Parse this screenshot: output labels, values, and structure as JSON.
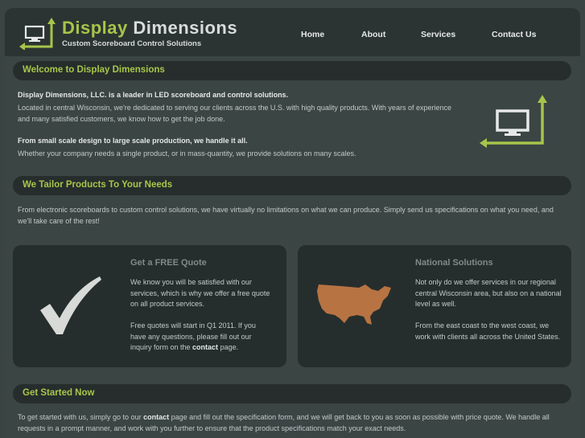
{
  "header": {
    "brand_word1": "Display",
    "brand_word2": "Dimensions",
    "tagline": "Custom Scoreboard Control Solutions",
    "nav": [
      "Home",
      "About",
      "Services",
      "Contact Us"
    ]
  },
  "welcome": {
    "heading": "Welcome to Display Dimensions",
    "lead1": "Display Dimensions, LLC. is a leader in LED scoreboard and control solutions.",
    "para1": "Located in central Wisconsin, we're dedicated to serving our clients across the U.S. with high quality products. With years of experience and many satisfied customers, we know how to get the job done.",
    "lead2": "From small scale design to large scale production, we handle it all.",
    "para2": "Whether your company needs a single product, or in mass-quantity, we provide solutions on many scales."
  },
  "tailor": {
    "heading": "We Tailor Products To Your Needs",
    "para": "From electronic scoreboards to custom control solutions, we have virtually no limitations on what we can produce. Simply send us specifications on what you need, and we'll take care of the rest!"
  },
  "quote_card": {
    "title": "Get a FREE Quote",
    "para1": "We know you will be satisfied with our services, which is why we offer a free quote on all product services.",
    "para2_before": "Free quotes will start in Q1 2011. If you have any questions, please fill out our inquiry form on the ",
    "para2_link": "contact",
    "para2_after": " page."
  },
  "national_card": {
    "title": "National Solutions",
    "para1": "Not only do we offer services in our regional central Wisconsin area, but also on a national level as well.",
    "para2": "From the east coast to the west coast, we work with clients all across the United States."
  },
  "started": {
    "heading": "Get Started Now",
    "para_before": "To get started with us, simply go to our ",
    "para_link": "contact",
    "para_after": " page and fill out the specification form, and we will get back to you as soon as possible with price quote. We handle all requests in a prompt manner, and work with you further to ensure that the product specifications match your exact needs."
  },
  "colors": {
    "accent": "#a9c64a",
    "map": "#b87342",
    "bar": "#262d2c"
  }
}
